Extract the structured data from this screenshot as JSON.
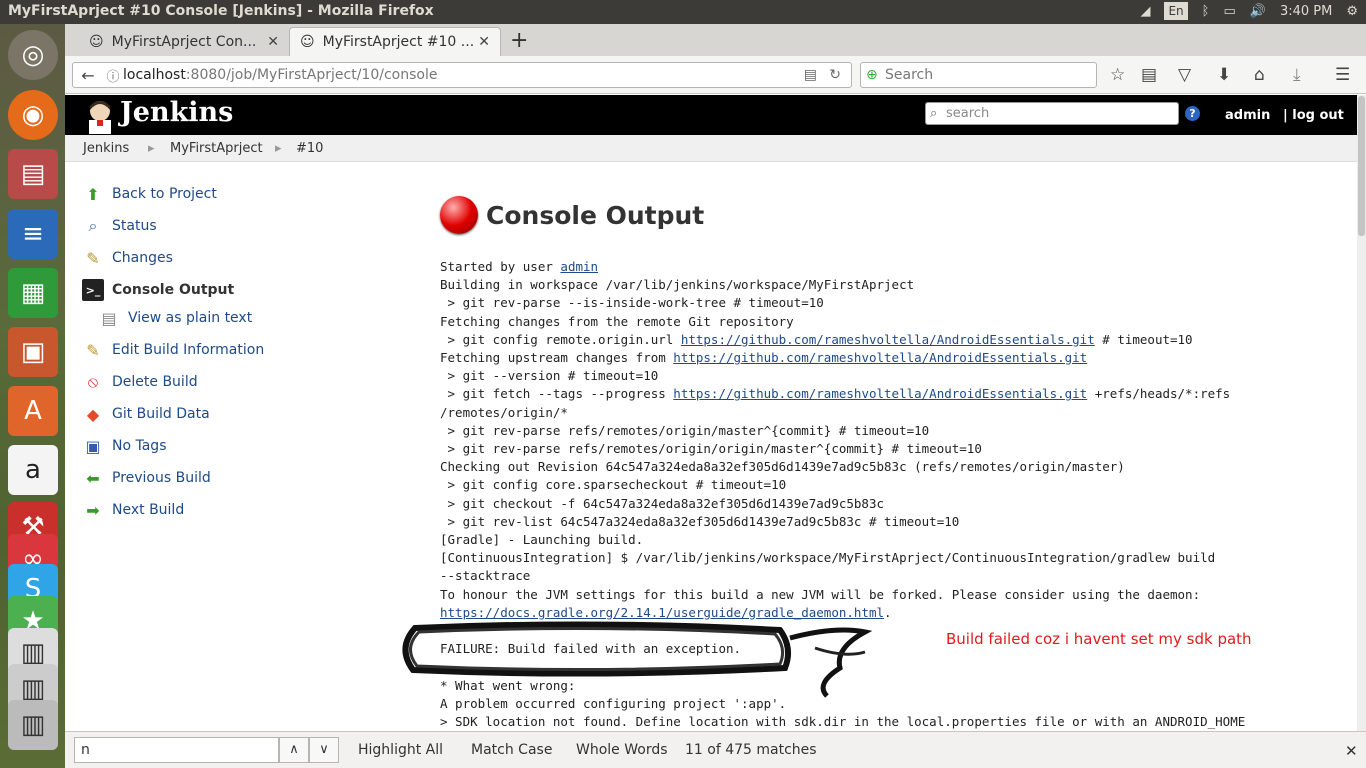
{
  "window": {
    "title": "MyFirstAprject #10 Console [Jenkins] - Mozilla Firefox"
  },
  "system_tray": {
    "keyboard": "En",
    "time": "3:40 PM"
  },
  "tabs": [
    {
      "label": "MyFirstAprject Con..."
    },
    {
      "label": "MyFirstAprject #10 ..."
    }
  ],
  "url": {
    "host": "localhost",
    "rest": ":8080/job/MyFirstAprject/10/console"
  },
  "browser_search": {
    "placeholder": "Search"
  },
  "jenkins": {
    "brand": "Jenkins",
    "search_placeholder": "search",
    "help": "?",
    "user": "admin",
    "logout": "| log out"
  },
  "breadcrumbs": [
    "Jenkins",
    "MyFirstAprject",
    "#10"
  ],
  "side_panel": [
    {
      "label": "Back to Project",
      "icon": "up-arrow-icon"
    },
    {
      "label": "Status",
      "icon": "magnifier-icon"
    },
    {
      "label": "Changes",
      "icon": "notepad-icon"
    },
    {
      "label": "Console Output",
      "icon": "terminal-icon"
    },
    {
      "label": "View as plain text",
      "icon": "document-icon"
    },
    {
      "label": "Edit Build Information",
      "icon": "notepad-icon"
    },
    {
      "label": "Delete Build",
      "icon": "no-entry-icon"
    },
    {
      "label": "Git Build Data",
      "icon": "git-icon"
    },
    {
      "label": "No Tags",
      "icon": "save-icon"
    },
    {
      "label": "Previous Build",
      "icon": "left-arrow-icon"
    },
    {
      "label": "Next Build",
      "icon": "right-arrow-icon"
    }
  ],
  "page_title": "Console Output",
  "console": {
    "started_by": "Started by user ",
    "user_link": "admin",
    "l2": "Building in workspace /var/lib/jenkins/workspace/MyFirstAprject",
    "l3": " > git rev-parse --is-inside-work-tree # timeout=10",
    "l4": "Fetching changes from the remote Git repository",
    "l5a": " > git config remote.origin.url ",
    "repo_url": "https://github.com/rameshvoltella/AndroidEssentials.git",
    "l5b": " # timeout=10",
    "l6a": "Fetching upstream changes from ",
    "l7": " > git --version # timeout=10",
    "l8a": " > git fetch --tags --progress ",
    "l8b": " +refs/heads/*:refs",
    "l9": "/remotes/origin/*",
    "l10": " > git rev-parse refs/remotes/origin/master^{commit} # timeout=10",
    "l11": " > git rev-parse refs/remotes/origin/origin/master^{commit} # timeout=10",
    "l12": "Checking out Revision 64c547a324eda8a32ef305d6d1439e7ad9c5b83c (refs/remotes/origin/master)",
    "l13": " > git config core.sparsecheckout # timeout=10",
    "l14": " > git checkout -f 64c547a324eda8a32ef305d6d1439e7ad9c5b83c",
    "l15": " > git rev-list 64c547a324eda8a32ef305d6d1439e7ad9c5b83c # timeout=10",
    "l16": "[Gradle] - Launching build.",
    "l17": "[ContinuousIntegration] $ /var/lib/jenkins/workspace/MyFirstAprject/ContinuousIntegration/gradlew build",
    "l18": "--stacktrace",
    "l19": "To honour the JVM settings for this build a new JVM will be forked. Please consider using the daemon:",
    "daemon_url": "https://docs.gradle.org/2.14.1/userguide/gradle_daemon.html",
    "l20b": ".",
    "l22": "FAILURE: Build failed with an exception.",
    "l24": "* What went wrong:",
    "l25": "A problem occurred configuring project ':app'.",
    "l26": "> SDK location not found. Define location with sdk.dir in the local.properties file or with an ANDROID_HOME"
  },
  "annotation": "Build failed coz i havent set my sdk path",
  "findbar": {
    "query": "n",
    "highlight_all": "Highlight All",
    "match_case": "Match Case",
    "whole_words": "Whole Words",
    "matches": "11 of 475 matches"
  }
}
